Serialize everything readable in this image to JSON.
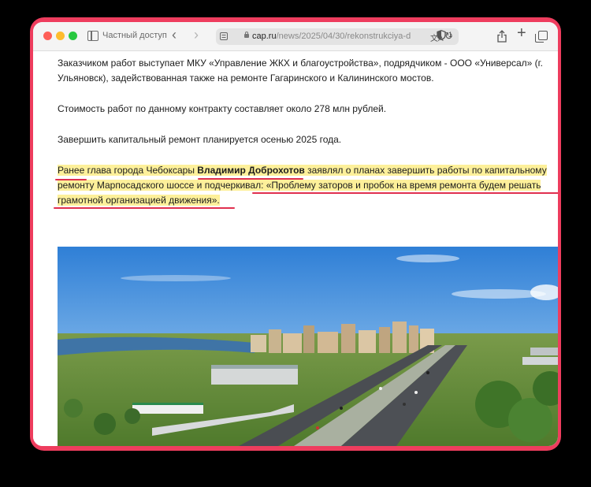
{
  "browser": {
    "private_label": "Частный доступ",
    "url_domain": "cap.ru",
    "url_path": "/news/2025/04/30/rekonstrukciya-",
    "url_trailing": "d",
    "tracker_count": "1"
  },
  "article": {
    "p1_line1": "Заказчиком работ выступает МКУ «Управление ЖКХ и благоустройства», подрядчиком - ООО «Универсал» (г.",
    "p1_line2": "Ульяновск), задействованная также на ремонте Гагаринского и Калининского мостов.",
    "p2": "Стоимость работ по данному контракту составляет около 278 млн рублей.",
    "p3": "Завершить капитальный ремонт планируется осенью 2025 года.",
    "quote_pre": "Ранее глава города Чебоксары ",
    "quote_name": "Владимир Доброхотов",
    "quote_post": " заявлял о планах завершить работы по капитальному",
    "quote_line2": "ремонту Марпосадского шоссе и подчеркивал: «Проблему заторов и пробок на время ремонта будем решать",
    "quote_line3": "грамотной организацией движения»."
  },
  "colors": {
    "frame": "#ee3d5e",
    "highlight": "#fdf09a",
    "underline": "#e0304f"
  },
  "icons": [
    "sidebar-icon",
    "back-icon",
    "forward-icon",
    "page-icon",
    "lock-icon",
    "translate-icon",
    "reload-icon",
    "shield-icon",
    "share-icon",
    "plus-icon",
    "tabs-icon"
  ]
}
